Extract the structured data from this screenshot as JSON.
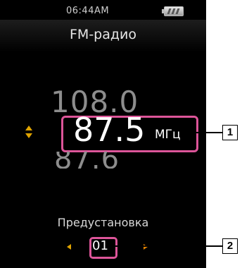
{
  "status_bar": {
    "time": "06:44AM",
    "battery_icon": "battery-icon"
  },
  "screen_title": "FM-радио",
  "frequency": {
    "previous": "108.0",
    "current": "87.5",
    "unit": "МГц",
    "next": "87.6"
  },
  "preset": {
    "label": "Предустановка",
    "value": "01"
  },
  "callouts": [
    "1",
    "2"
  ],
  "colors": {
    "highlight_border": "#dd5599",
    "arrow_accent": "#e0a400",
    "background": "#000000"
  }
}
